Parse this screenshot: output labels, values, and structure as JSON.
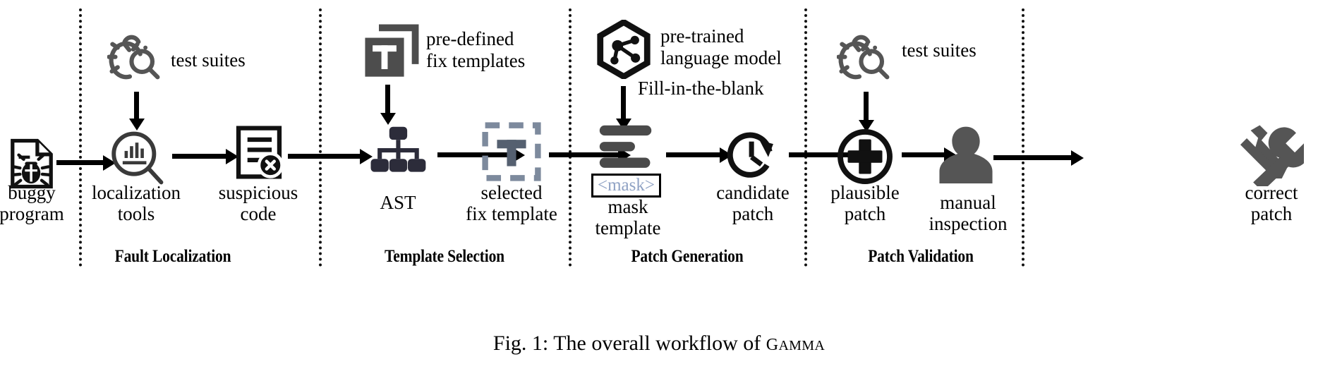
{
  "figure": {
    "caption_prefix": "Fig. 1: The overall workflow of ",
    "caption_subject": "Gamma",
    "caption_full": "Fig. 1: The overall workflow of Gamma"
  },
  "stages": [
    {
      "id": "fault-localization",
      "label": "Fault Localization"
    },
    {
      "id": "template-selection",
      "label": "Template Selection"
    },
    {
      "id": "patch-generation",
      "label": "Patch Generation"
    },
    {
      "id": "patch-validation",
      "label": "Patch Validation"
    }
  ],
  "nodes": [
    {
      "id": "buggy-program",
      "icon": "buggy-file-icon",
      "label_line1": "buggy",
      "label_line2": "program"
    },
    {
      "id": "localization-tools",
      "icon": "magnifier-chart-icon",
      "label_line1": "localization",
      "label_line2": "tools"
    },
    {
      "id": "suspicious-code",
      "icon": "document-error-icon",
      "label_line1": "suspicious",
      "label_line2": "code"
    },
    {
      "id": "ast",
      "icon": "tree-hierarchy-icon",
      "label_line1": "AST",
      "label_line2": ""
    },
    {
      "id": "selected-fix-template",
      "icon": "dashed-template-t-icon",
      "label_line1": "selected",
      "label_line2": "fix template"
    },
    {
      "id": "mask-template",
      "icon": "text-lines-icon",
      "label_line1": "mask",
      "label_line2": "template"
    },
    {
      "id": "candidate-patch",
      "icon": "clock-history-icon",
      "label_line1": "candidate",
      "label_line2": "patch"
    },
    {
      "id": "plausible-patch",
      "icon": "circle-plus-icon",
      "label_line1": "plausible",
      "label_line2": "patch"
    },
    {
      "id": "manual-inspection",
      "icon": "person-silhouette-icon",
      "label_line1": "manual",
      "label_line2": "inspection"
    },
    {
      "id": "correct-patch",
      "icon": "wrench-screwdriver-icon",
      "label_line1": "correct",
      "label_line2": "patch"
    }
  ],
  "inputs": [
    {
      "id": "test-suites-fl",
      "icon": "bug-magnifier-icon",
      "label": "test suites"
    },
    {
      "id": "fix-templates",
      "icon": "template-stack-t-icon",
      "label_line1": "pre-defined",
      "label_line2": "fix templates"
    },
    {
      "id": "language-model",
      "icon": "hexagon-network-icon",
      "label_line1": "pre-trained",
      "label_line2": "language model"
    },
    {
      "id": "test-suites-pv",
      "icon": "bug-magnifier-icon",
      "label": "test suites"
    }
  ],
  "annotations": {
    "fill_in_the_blank": "Fill-in-the-blank",
    "mask_token": "<mask>"
  },
  "colors": {
    "black": "#111111",
    "gray_icon": "#555555",
    "dark_slate": "#2c2c3a",
    "slate_blue": "#7d8a9d",
    "slate_dark": "#556070",
    "mask_text": "#8fa2c4",
    "template_gray": "#4d4d4d"
  }
}
